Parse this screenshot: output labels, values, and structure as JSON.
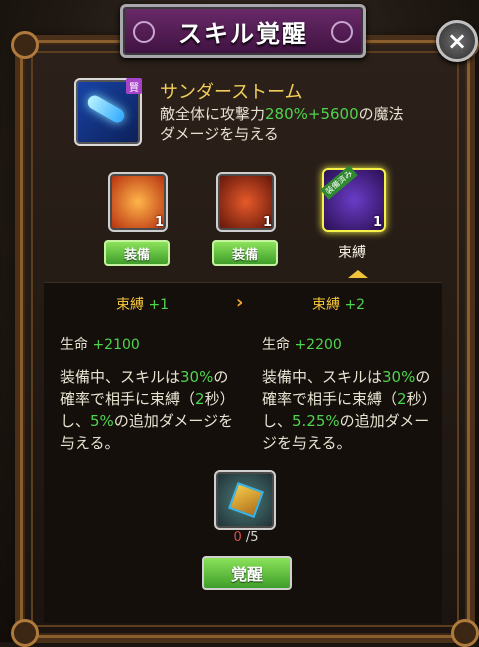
{
  "title": "スキル覚醒",
  "skill": {
    "badge": "賢",
    "name": "サンダーストーム",
    "desc_prefix": "敵全体に攻撃力",
    "desc_pct": "280%",
    "desc_plus": "+5600",
    "desc_suffix": "の魔法ダメージを与える"
  },
  "equipment": [
    {
      "icon": "flame-shield-icon",
      "level": "1",
      "button": "装備"
    },
    {
      "icon": "red-armor-icon",
      "level": "1",
      "button": "装備"
    },
    {
      "icon": "purple-rune-icon",
      "level": "1",
      "tag": "装備済み",
      "label": "束縛"
    }
  ],
  "compare": {
    "left": {
      "head": "束縛",
      "head_plus": "+1",
      "stat_label": "生命",
      "stat_value": "+2100",
      "effect_a": "装備中、スキルは",
      "effect_pct": "30%",
      "effect_b": "の確率で相手に束縛（",
      "effect_sec": "2",
      "effect_c": "秒）し、",
      "effect_dmg": "5%",
      "effect_d": "の追加ダメージを与える。"
    },
    "right": {
      "head": "束縛",
      "head_plus": "+2",
      "stat_label": "生命",
      "stat_value": "+2200",
      "effect_a": "装備中、スキルは",
      "effect_pct": "30%",
      "effect_b": "の確率で相手に束縛（",
      "effect_sec": "2",
      "effect_c": "秒）し、",
      "effect_dmg": "5.25%",
      "effect_d": "の追加ダメージを与える。"
    },
    "arrow": "›"
  },
  "material": {
    "icon": "awaken-crystal-icon",
    "have": "0",
    "need": "/5"
  },
  "awaken_button": "覚醒",
  "close_icon": "×",
  "colors": {
    "gold": "#f2c43a",
    "green": "#4ed44e",
    "red": "#e04c4c",
    "banner": "#6a2a6a"
  }
}
